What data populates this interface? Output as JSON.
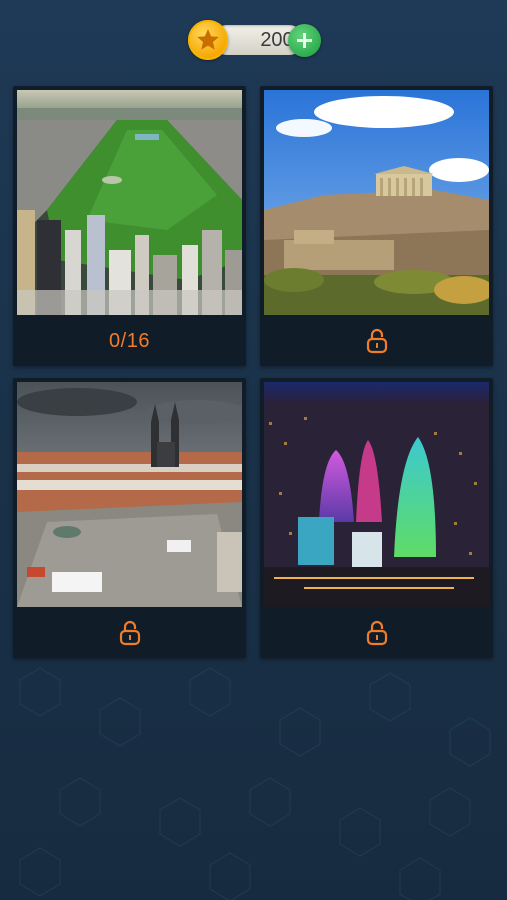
{
  "header": {
    "coins": "200",
    "coin_icon": "star-coin-icon",
    "add_icon": "plus-icon"
  },
  "colors": {
    "background": "#1c3550",
    "card": "#101c28",
    "accent_orange": "#f07d2a",
    "coin_gold": "#f5a500",
    "plus_green": "#2fae4f"
  },
  "levels": [
    {
      "image": "central-park-new-york",
      "status": "0/16",
      "locked": false
    },
    {
      "image": "acropolis-athens",
      "status": "",
      "locked": true
    },
    {
      "image": "old-town-square-prague",
      "status": "",
      "locked": true
    },
    {
      "image": "flame-towers-baku-night",
      "status": "",
      "locked": true
    }
  ]
}
